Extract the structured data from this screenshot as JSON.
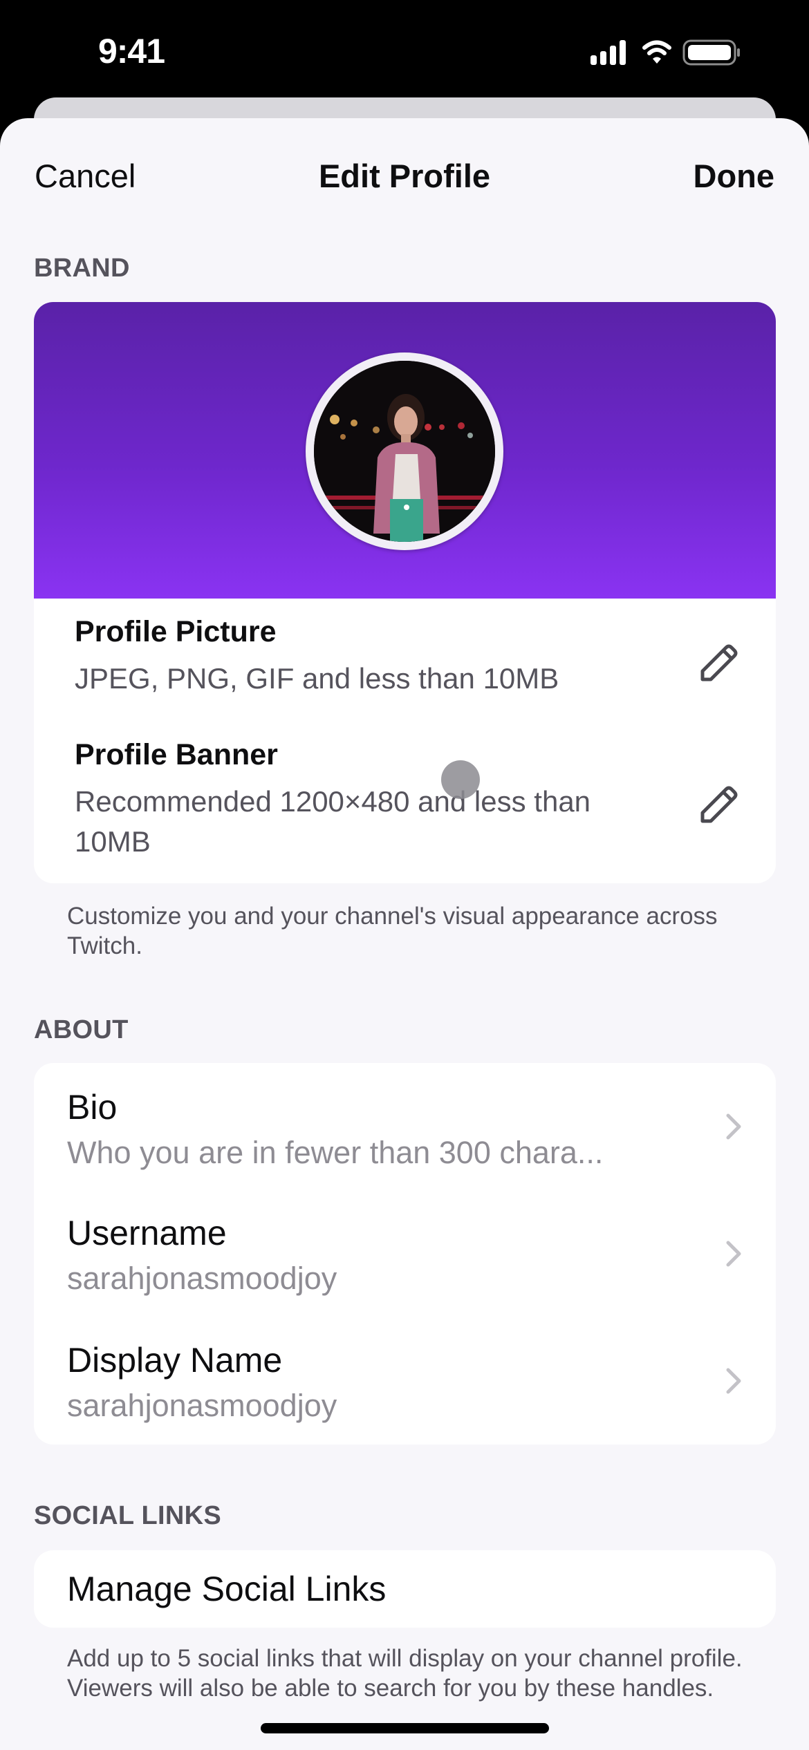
{
  "status_bar": {
    "time": "9:41",
    "icons": [
      "cellular-signal-icon",
      "wifi-icon",
      "battery-icon"
    ]
  },
  "header": {
    "cancel_label": "Cancel",
    "title": "Edit Profile",
    "done_label": "Done"
  },
  "brand": {
    "section_label": "BRAND",
    "banner_colors": [
      "#5A22A8",
      "#8A33F2"
    ],
    "profile_picture": {
      "title": "Profile Picture",
      "subtitle": "JPEG, PNG, GIF and less than 10MB",
      "icon": "pencil-icon"
    },
    "profile_banner": {
      "title": "Profile Banner",
      "subtitle": "Recommended 1200×480 and less than 10MB",
      "icon": "pencil-icon"
    },
    "caption": "Customize you and your channel's visual appearance across Twitch."
  },
  "about": {
    "section_label": "ABOUT",
    "items": [
      {
        "title": "Bio",
        "value": "Who you are in fewer than 300 chara...",
        "icon": "chevron-right-icon"
      },
      {
        "title": "Username",
        "value": "sarahjonasmoodjoy",
        "icon": "chevron-right-icon"
      },
      {
        "title": "Display Name",
        "value": "sarahjonasmoodjoy",
        "icon": "chevron-right-icon"
      }
    ]
  },
  "social_links": {
    "section_label": "SOCIAL LINKS",
    "manage_label": "Manage Social Links",
    "caption": "Add up to 5 social links that will display on your channel profile. Viewers will also be able to search for you by these handles."
  },
  "colors": {
    "accent": "#8A33F2",
    "text_primary": "#0E0E10",
    "text_secondary": "#55535C",
    "text_placeholder": "#8E8C93",
    "sheet_background": "#F7F6FA"
  }
}
